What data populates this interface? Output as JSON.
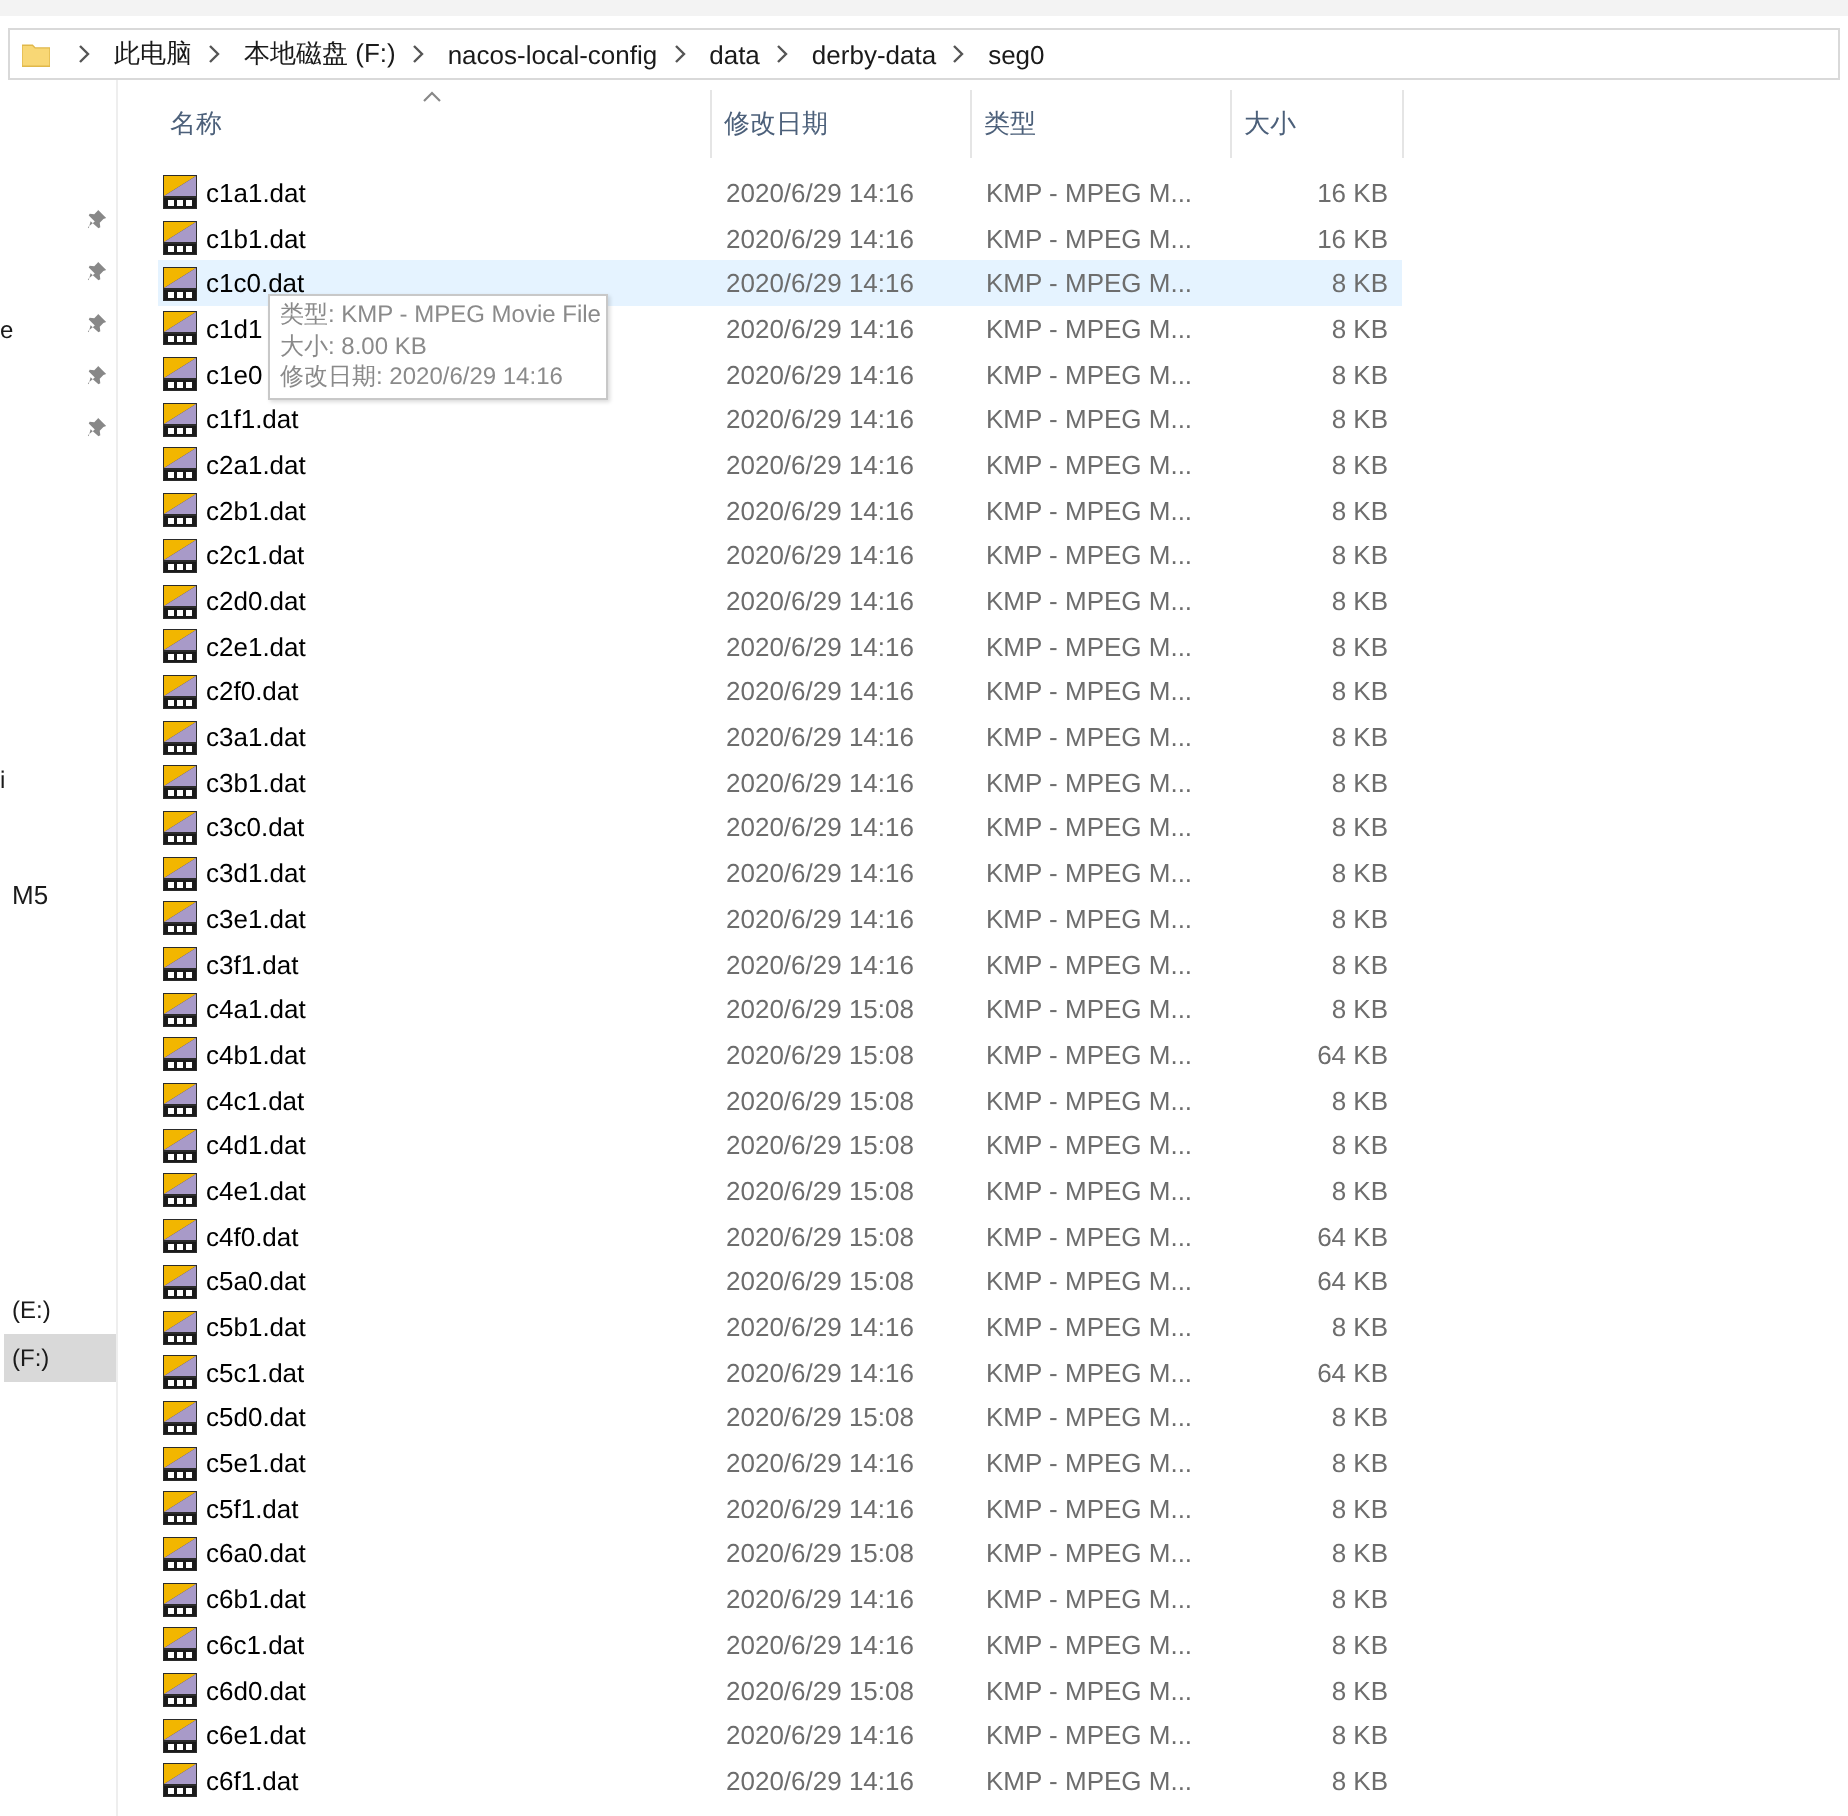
{
  "breadcrumb": [
    "此电脑",
    "本地磁盘 (F:)",
    "nacos-local-config",
    "data",
    "derby-data",
    "seg0"
  ],
  "sidebar": {
    "items": [
      {
        "label": "e",
        "selected": false
      },
      {
        "label": "i",
        "selected": false
      },
      {
        "label": "M5",
        "selected": false
      },
      {
        "label": "(E:)",
        "selected": false
      },
      {
        "label": "(F:)",
        "selected": true
      }
    ]
  },
  "columns": [
    {
      "label": "名称",
      "sorted": true
    },
    {
      "label": "修改日期",
      "sorted": false
    },
    {
      "label": "类型",
      "sorted": false
    },
    {
      "label": "大小",
      "sorted": false
    }
  ],
  "files": [
    {
      "name": "c1a1.dat",
      "date": "2020/6/29 14:16",
      "type": "KMP - MPEG M...",
      "size": "16 KB",
      "selected": false
    },
    {
      "name": "c1b1.dat",
      "date": "2020/6/29 14:16",
      "type": "KMP - MPEG M...",
      "size": "16 KB",
      "selected": false
    },
    {
      "name": "c1c0.dat",
      "date": "2020/6/29 14:16",
      "type": "KMP - MPEG M...",
      "size": "8 KB",
      "selected": true
    },
    {
      "name": "c1d1",
      "date": "2020/6/29 14:16",
      "type": "KMP - MPEG M...",
      "size": "8 KB",
      "selected": false
    },
    {
      "name": "c1e0",
      "date": "2020/6/29 14:16",
      "type": "KMP - MPEG M...",
      "size": "8 KB",
      "selected": false
    },
    {
      "name": "c1f1.dat",
      "date": "2020/6/29 14:16",
      "type": "KMP - MPEG M...",
      "size": "8 KB",
      "selected": false
    },
    {
      "name": "c2a1.dat",
      "date": "2020/6/29 14:16",
      "type": "KMP - MPEG M...",
      "size": "8 KB",
      "selected": false
    },
    {
      "name": "c2b1.dat",
      "date": "2020/6/29 14:16",
      "type": "KMP - MPEG M...",
      "size": "8 KB",
      "selected": false
    },
    {
      "name": "c2c1.dat",
      "date": "2020/6/29 14:16",
      "type": "KMP - MPEG M...",
      "size": "8 KB",
      "selected": false
    },
    {
      "name": "c2d0.dat",
      "date": "2020/6/29 14:16",
      "type": "KMP - MPEG M...",
      "size": "8 KB",
      "selected": false
    },
    {
      "name": "c2e1.dat",
      "date": "2020/6/29 14:16",
      "type": "KMP - MPEG M...",
      "size": "8 KB",
      "selected": false
    },
    {
      "name": "c2f0.dat",
      "date": "2020/6/29 14:16",
      "type": "KMP - MPEG M...",
      "size": "8 KB",
      "selected": false
    },
    {
      "name": "c3a1.dat",
      "date": "2020/6/29 14:16",
      "type": "KMP - MPEG M...",
      "size": "8 KB",
      "selected": false
    },
    {
      "name": "c3b1.dat",
      "date": "2020/6/29 14:16",
      "type": "KMP - MPEG M...",
      "size": "8 KB",
      "selected": false
    },
    {
      "name": "c3c0.dat",
      "date": "2020/6/29 14:16",
      "type": "KMP - MPEG M...",
      "size": "8 KB",
      "selected": false
    },
    {
      "name": "c3d1.dat",
      "date": "2020/6/29 14:16",
      "type": "KMP - MPEG M...",
      "size": "8 KB",
      "selected": false
    },
    {
      "name": "c3e1.dat",
      "date": "2020/6/29 14:16",
      "type": "KMP - MPEG M...",
      "size": "8 KB",
      "selected": false
    },
    {
      "name": "c3f1.dat",
      "date": "2020/6/29 14:16",
      "type": "KMP - MPEG M...",
      "size": "8 KB",
      "selected": false
    },
    {
      "name": "c4a1.dat",
      "date": "2020/6/29 15:08",
      "type": "KMP - MPEG M...",
      "size": "8 KB",
      "selected": false
    },
    {
      "name": "c4b1.dat",
      "date": "2020/6/29 15:08",
      "type": "KMP - MPEG M...",
      "size": "64 KB",
      "selected": false
    },
    {
      "name": "c4c1.dat",
      "date": "2020/6/29 15:08",
      "type": "KMP - MPEG M...",
      "size": "8 KB",
      "selected": false
    },
    {
      "name": "c4d1.dat",
      "date": "2020/6/29 15:08",
      "type": "KMP - MPEG M...",
      "size": "8 KB",
      "selected": false
    },
    {
      "name": "c4e1.dat",
      "date": "2020/6/29 15:08",
      "type": "KMP - MPEG M...",
      "size": "8 KB",
      "selected": false
    },
    {
      "name": "c4f0.dat",
      "date": "2020/6/29 15:08",
      "type": "KMP - MPEG M...",
      "size": "64 KB",
      "selected": false
    },
    {
      "name": "c5a0.dat",
      "date": "2020/6/29 15:08",
      "type": "KMP - MPEG M...",
      "size": "64 KB",
      "selected": false
    },
    {
      "name": "c5b1.dat",
      "date": "2020/6/29 14:16",
      "type": "KMP - MPEG M...",
      "size": "8 KB",
      "selected": false
    },
    {
      "name": "c5c1.dat",
      "date": "2020/6/29 14:16",
      "type": "KMP - MPEG M...",
      "size": "64 KB",
      "selected": false
    },
    {
      "name": "c5d0.dat",
      "date": "2020/6/29 15:08",
      "type": "KMP - MPEG M...",
      "size": "8 KB",
      "selected": false
    },
    {
      "name": "c5e1.dat",
      "date": "2020/6/29 14:16",
      "type": "KMP - MPEG M...",
      "size": "8 KB",
      "selected": false
    },
    {
      "name": "c5f1.dat",
      "date": "2020/6/29 14:16",
      "type": "KMP - MPEG M...",
      "size": "8 KB",
      "selected": false
    },
    {
      "name": "c6a0.dat",
      "date": "2020/6/29 15:08",
      "type": "KMP - MPEG M...",
      "size": "8 KB",
      "selected": false
    },
    {
      "name": "c6b1.dat",
      "date": "2020/6/29 14:16",
      "type": "KMP - MPEG M...",
      "size": "8 KB",
      "selected": false
    },
    {
      "name": "c6c1.dat",
      "date": "2020/6/29 14:16",
      "type": "KMP - MPEG M...",
      "size": "8 KB",
      "selected": false
    },
    {
      "name": "c6d0.dat",
      "date": "2020/6/29 15:08",
      "type": "KMP - MPEG M...",
      "size": "8 KB",
      "selected": false
    },
    {
      "name": "c6e1.dat",
      "date": "2020/6/29 14:16",
      "type": "KMP - MPEG M...",
      "size": "8 KB",
      "selected": false
    },
    {
      "name": "c6f1.dat",
      "date": "2020/6/29 14:16",
      "type": "KMP - MPEG M...",
      "size": "8 KB",
      "selected": false
    }
  ],
  "tooltip": [
    "类型: KMP - MPEG Movie File",
    "大小: 8.00 KB",
    "修改日期: 2020/6/29 14:16"
  ]
}
